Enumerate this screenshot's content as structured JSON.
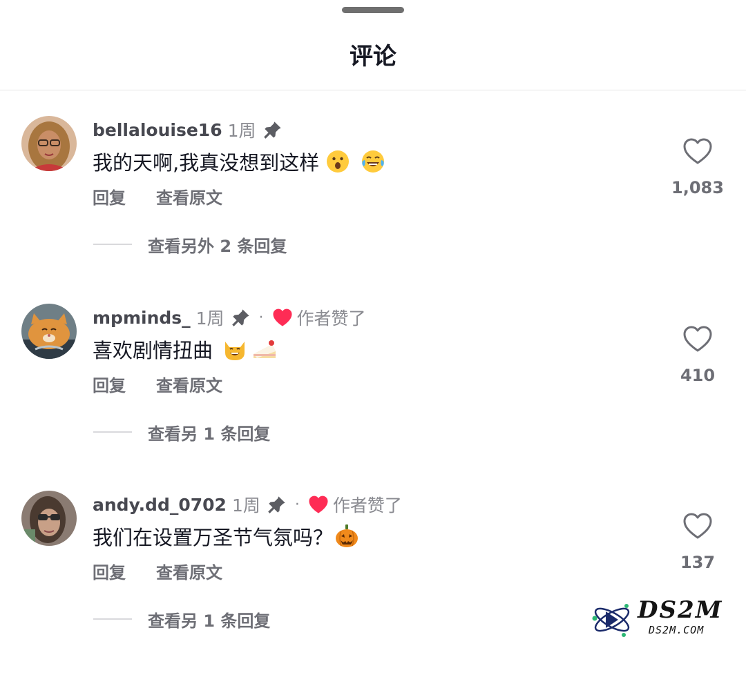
{
  "sheet": {
    "title": "评论"
  },
  "comments": [
    {
      "username": "bellalouise16",
      "time": "1周",
      "pinned": true,
      "creator_liked": false,
      "text": "我的天啊,我真没想到这样",
      "emojis": [
        "surprised-face",
        "tears-of-joy-face"
      ],
      "reply_label": "回复",
      "translate_label": "查看原文",
      "replies_label": "查看另外 2 条回复",
      "like_count": "1,083"
    },
    {
      "username": "mpminds_",
      "time": "1周",
      "pinned": true,
      "creator_liked": true,
      "dot": "·",
      "creator_liked_text": "作者赞了",
      "text": "喜欢剧情扭曲",
      "emojis": [
        "grinning-cat",
        "shortcake"
      ],
      "reply_label": "回复",
      "translate_label": "查看原文",
      "replies_label": "查看另 1 条回复",
      "like_count": "410"
    },
    {
      "username": "andy.dd_0702",
      "time": "1周",
      "pinned": true,
      "creator_liked": true,
      "dot": "·",
      "creator_liked_text": "作者赞了",
      "text": "我们在设置万圣节气氛吗？",
      "emojis": [
        "jack-o-lantern"
      ],
      "reply_label": "回复",
      "translate_label": "查看原文",
      "replies_label": "查看另 1 条回复",
      "like_count": "137"
    }
  ],
  "watermark": {
    "brand": "DS2M",
    "domain": "DS2M.COM"
  },
  "colors": {
    "creator_heart": "#fe2c55",
    "text_primary": "#161823",
    "text_secondary": "#8a8b91"
  }
}
